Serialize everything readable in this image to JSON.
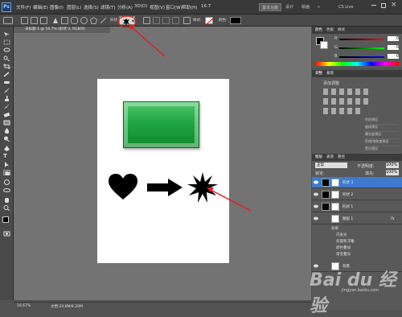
{
  "menubar": {
    "ps_logo": "Ps",
    "items": [
      "文件(F)",
      "编辑(E)",
      "图像(I)",
      "图层(L)",
      "选择(S)",
      "滤镜(T)",
      "分析(A)",
      "3D(D)",
      "视图(V)",
      "窗口(W)",
      "帮助(H)"
    ],
    "zoom_value": "16.7",
    "workspaces": [
      "基本功能",
      "设计",
      "绘画",
      "»"
    ],
    "cs_live": "CS Live"
  },
  "optionsbar": {
    "shape_label": "形状:",
    "style_label": "样式:",
    "color_label": "颜色:"
  },
  "document": {
    "tab_title": "未标题-1 @ 16.7% (形状 3, RGB/8)",
    "zoom_status": "16.67%",
    "doc_size": "文档:24.8M/8.20M"
  },
  "panels": {
    "color_tab": "颜色",
    "swatches_tab": "色板",
    "styles_tab": "样式",
    "color_sliders": [
      {
        "label": "R",
        "value": "0"
      },
      {
        "label": "G",
        "value": "0"
      },
      {
        "label": "B",
        "value": "0"
      }
    ],
    "adjust_tabs": [
      "调整",
      "蒙版"
    ],
    "adjust_title": "添加调整",
    "adjust_items": [
      "色阶预设",
      "曲线预设",
      "曝光度预设",
      "色相/饱和度预设",
      "黑白预设",
      "通道混合器预设",
      "可选颜色预设"
    ],
    "layers_tab": "图层",
    "channels_tab": "通道",
    "paths_tab": "路径",
    "blend_mode": "正常",
    "opacity_label": "不透明度:",
    "opacity_value": "100%",
    "lock_label": "锁定:",
    "fill_label": "填充:",
    "fill_value": "100%",
    "layers": [
      {
        "name": "形状 3",
        "selected": true
      },
      {
        "name": "形状 2",
        "selected": false
      },
      {
        "name": "形状 1",
        "selected": false
      },
      {
        "name": "图层 1",
        "selected": false,
        "fx": "fx"
      },
      {
        "name": "背景",
        "selected": false
      }
    ],
    "effects_title": "效果",
    "effects": [
      "内发光",
      "斜面和浮雕",
      "颜色叠加",
      "渐变叠加"
    ]
  },
  "watermark": {
    "text": "Bai du 经验",
    "sub": "jingyan.baidu.com"
  },
  "colors": {
    "green_start": "#4fc86a",
    "green_end": "#0f8a2c",
    "arrow_red": "#e02020",
    "layer_selected": "#3d7ad0"
  }
}
